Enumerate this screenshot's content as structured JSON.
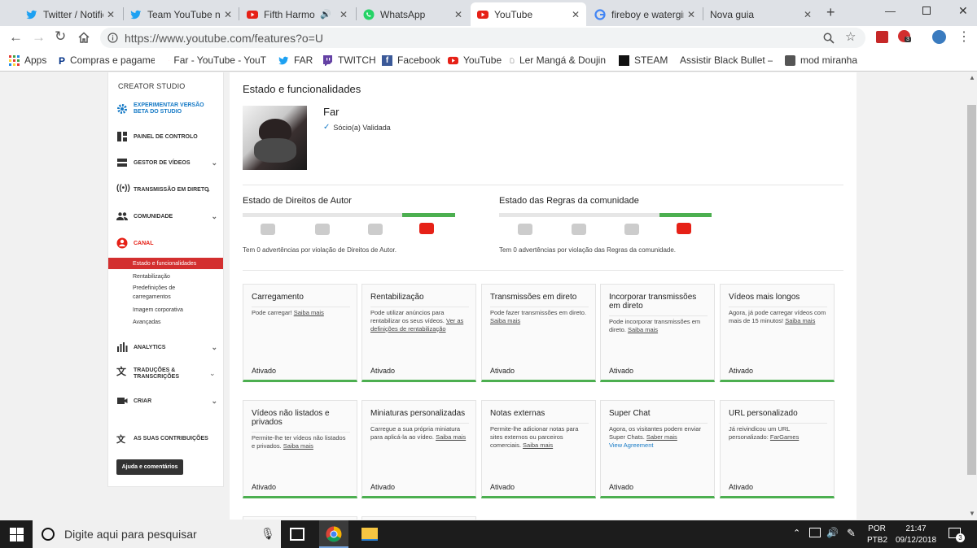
{
  "browser": {
    "tabs": [
      {
        "title": "Twitter / Notificaçõ",
        "icon": "twitter-icon"
      },
      {
        "title": "Team YouTube no",
        "icon": "twitter-icon"
      },
      {
        "title": "Fifth Harmony",
        "icon": "youtube-icon"
      },
      {
        "title": "WhatsApp",
        "icon": "whatsapp-icon"
      },
      {
        "title": "YouTube",
        "icon": "youtube-icon"
      },
      {
        "title": "fireboy e watergirl",
        "icon": "google-icon"
      },
      {
        "title": "Nova guia",
        "icon": ""
      }
    ],
    "url": "https://www.youtube.com/features?o=U",
    "profile_badge": "3",
    "bookmarks": [
      "Apps",
      "Compras e pagamen",
      "Far - YouTube - YouT",
      "FAR",
      "TWITCH",
      "Facebook",
      "YouTube",
      "Ler Mangá & Doujin",
      "STEAM",
      "Assistir Black Bullet –",
      "mod miranha"
    ]
  },
  "sidebar": {
    "header": "CREATOR STUDIO",
    "beta": "EXPERIMENTAR VERSÃO BETA DO STUDIO",
    "items": [
      {
        "label": "PAINEL DE CONTROLO",
        "icon": "dashboard-icon"
      },
      {
        "label": "GESTOR DE VÍDEOS",
        "icon": "video-manager-icon"
      },
      {
        "label": "TRANSMISSÃO EM DIRETO",
        "icon": "live-icon"
      },
      {
        "label": "COMUNIDADE",
        "icon": "community-icon"
      },
      {
        "label": "CANAL",
        "icon": "channel-icon"
      }
    ],
    "sub_items": [
      "Estado e funcionalidades",
      "Rentabilização",
      "Predefinições de carregamentos",
      "Imagem corporativa",
      "Avançadas"
    ],
    "items2": [
      {
        "label": "ANALYTICS",
        "icon": "analytics-icon"
      },
      {
        "label": "TRADUÇÕES & TRANSCRIÇÕES",
        "icon": "translate-icon"
      },
      {
        "label": "CRIAR",
        "icon": "create-icon"
      },
      {
        "label": "AS SUAS CONTRIBUIÇÕES",
        "icon": "contributions-icon"
      }
    ],
    "help": "Ajuda e comentários"
  },
  "main": {
    "title": "Estado e funcionalidades",
    "channel_name": "Far",
    "partner_status": "Sócio(a) Validada",
    "copyright": {
      "title": "Estado de Direitos de Autor",
      "note": "Tem 0 advertências por violação de Direitos de Autor."
    },
    "community": {
      "title": "Estado das Regras da comunidade",
      "note": "Tem 0 advertências por violação das Regras da comunidade."
    },
    "cards": [
      {
        "title": "Carregamento",
        "desc": "Pode carregar!",
        "link": "Saiba mais",
        "status": "Ativado"
      },
      {
        "title": "Rentabilização",
        "desc": "Pode utilizar anúncios para rentabilizar os seus vídeos.",
        "link": "Ver as definições de rentabilização",
        "status": "Ativado"
      },
      {
        "title": "Transmissões em direto",
        "desc": "Pode fazer transmissões em direto.",
        "link": "Saiba mais",
        "status": "Ativado"
      },
      {
        "title": "Incorporar transmissões em direto",
        "desc": "Pode incorporar transmissões em direto.",
        "link": "Saiba mais",
        "status": "Ativado"
      },
      {
        "title": "Vídeos mais longos",
        "desc": "Agora, já pode carregar vídeos com mais de 15 minutos!",
        "link": "Saiba mais",
        "status": "Ativado"
      },
      {
        "title": "Vídeos não listados e privados",
        "desc": "Permite-lhe ter vídeos não listados e privados.",
        "link": "Saiba mais",
        "status": "Ativado"
      },
      {
        "title": "Miniaturas personalizadas",
        "desc": "Carregue a sua própria miniatura para aplicá-la ao vídeo.",
        "link": "Saiba mais",
        "status": "Ativado"
      },
      {
        "title": "Notas externas",
        "desc": "Permite-lhe adicionar notas para sites externos ou parceiros comerciais.",
        "link": "Saiba mais",
        "status": "Ativado"
      },
      {
        "title": "Super Chat",
        "desc": "Agora, os visitantes podem enviar Super Chats.",
        "link": "Saber mais",
        "extra": "View Agreement",
        "status": "Ativado"
      },
      {
        "title": "URL personalizado",
        "desc": "Já reivindicou um URL personalizado:",
        "link": "FarGames",
        "status": "Ativado"
      }
    ]
  },
  "taskbar": {
    "search_placeholder": "Digite aqui para pesquisar",
    "lang": "POR",
    "layout": "PTB2",
    "time": "21:47",
    "date": "09/12/2018",
    "notif_count": "3"
  },
  "colors": {
    "accent": "#e62117",
    "ok": "#4caf50",
    "link": "#167ac6"
  }
}
